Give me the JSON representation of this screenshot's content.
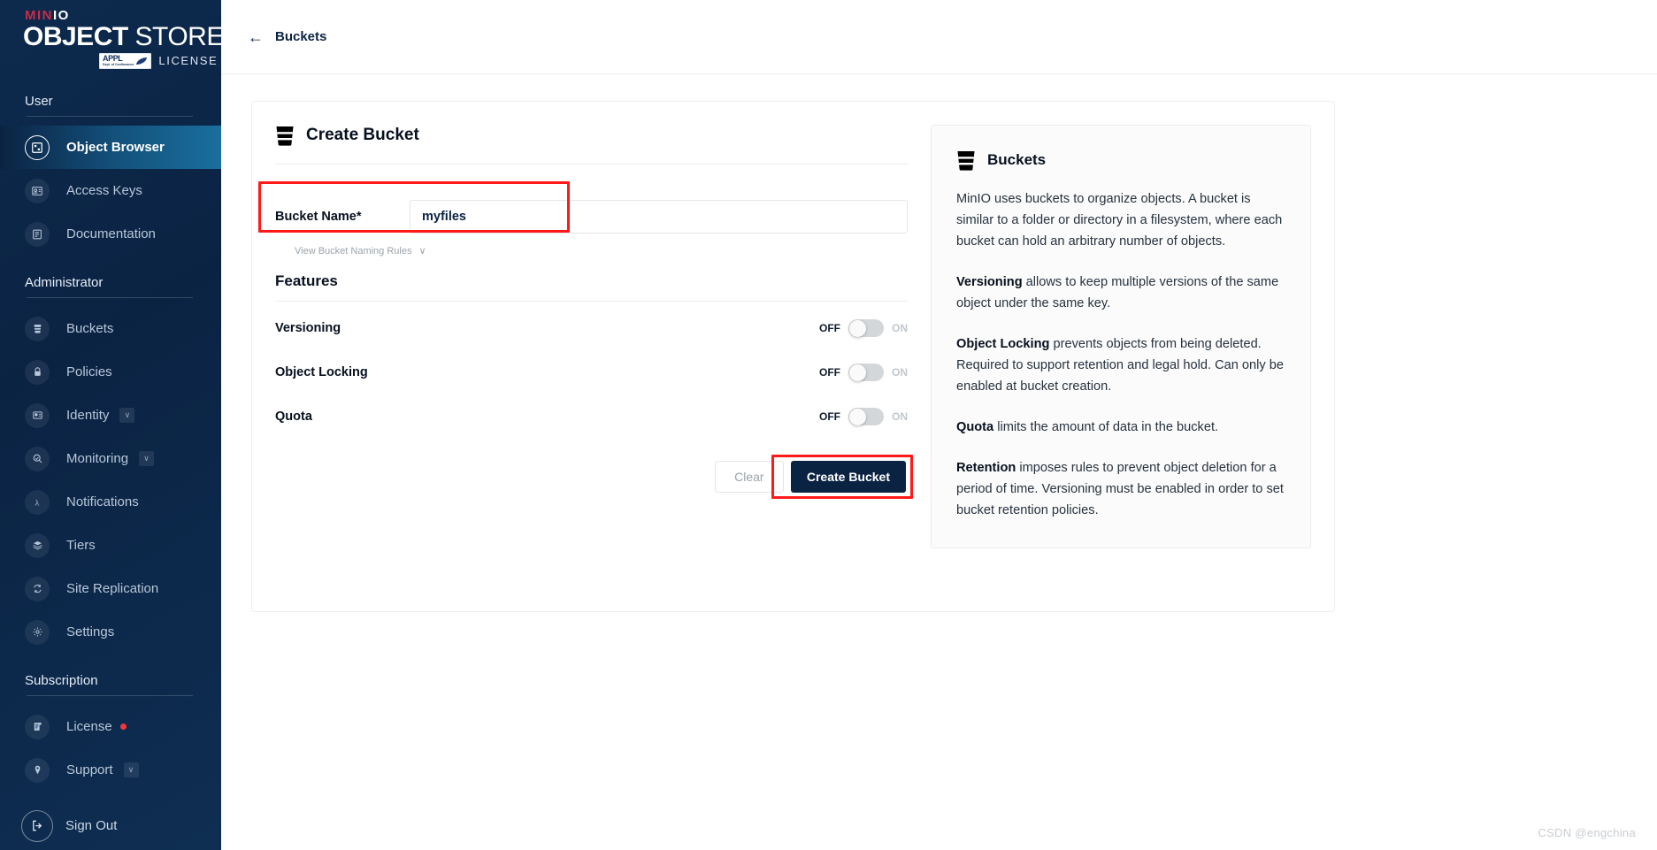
{
  "brand": {
    "minio": "MIN",
    "minio_io": "IO",
    "object": "OBJECT",
    "store": "STORE",
    "badge_main": "APPL",
    "badge_sub": "Dept. of Confirmance",
    "license": "LICENSE"
  },
  "sidebar": {
    "sections": [
      {
        "title": "User",
        "items": [
          {
            "label": "Object Browser",
            "icon": "object-browser-icon",
            "active": true
          },
          {
            "label": "Access Keys",
            "icon": "access-keys-icon",
            "active": false
          },
          {
            "label": "Documentation",
            "icon": "documentation-icon",
            "active": false
          }
        ]
      },
      {
        "title": "Administrator",
        "items": [
          {
            "label": "Buckets",
            "icon": "buckets-icon",
            "active": false
          },
          {
            "label": "Policies",
            "icon": "policies-icon",
            "active": false
          },
          {
            "label": "Identity",
            "icon": "identity-icon",
            "active": false,
            "chevron": "∨"
          },
          {
            "label": "Monitoring",
            "icon": "monitoring-icon",
            "active": false,
            "chevron": "∨"
          },
          {
            "label": "Notifications",
            "icon": "notifications-icon",
            "active": false
          },
          {
            "label": "Tiers",
            "icon": "tiers-icon",
            "active": false
          },
          {
            "label": "Site Replication",
            "icon": "site-replication-icon",
            "active": false
          },
          {
            "label": "Settings",
            "icon": "settings-icon",
            "active": false
          }
        ]
      },
      {
        "title": "Subscription",
        "items": [
          {
            "label": "License",
            "icon": "license-icon",
            "active": false,
            "dot": true
          },
          {
            "label": "Support",
            "icon": "support-icon",
            "active": false,
            "chevron": "∨"
          }
        ]
      }
    ],
    "sign_out": {
      "label": "Sign Out",
      "icon": "sign-out-icon"
    }
  },
  "topbar": {
    "back_icon": "←",
    "breadcrumb": "Buckets"
  },
  "create_bucket": {
    "title": "Create Bucket",
    "title_icon": "bucket-icon",
    "bucket_name_label": "Bucket Name*",
    "bucket_name_value": "myfiles",
    "bucket_name_placeholder": "",
    "naming_rules_label": "View Bucket Naming Rules",
    "naming_rules_chevron": "∨",
    "features_title": "Features",
    "features": [
      {
        "name": "Versioning",
        "off_label": "OFF",
        "on_label": "ON",
        "state": "OFF"
      },
      {
        "name": "Object Locking",
        "off_label": "OFF",
        "on_label": "ON",
        "state": "OFF"
      },
      {
        "name": "Quota",
        "off_label": "OFF",
        "on_label": "ON",
        "state": "OFF"
      }
    ],
    "clear_label": "Clear",
    "submit_label": "Create Bucket"
  },
  "info_panel": {
    "title": "Buckets",
    "title_icon": "bucket-icon",
    "paragraphs": [
      {
        "lead": "",
        "text": "MinIO uses buckets to organize objects. A bucket is similar to a folder or directory in a filesystem, where each bucket can hold an arbitrary number of objects."
      },
      {
        "lead": "Versioning",
        "text": " allows to keep multiple versions of the same object under the same key."
      },
      {
        "lead": "Object Locking",
        "text": " prevents objects from being deleted. Required to support retention and legal hold. Can only be enabled at bucket creation."
      },
      {
        "lead": "Quota",
        "text": " limits the amount of data in the bucket."
      },
      {
        "lead": "Retention",
        "text": " imposes rules to prevent object deletion for a period of time. Versioning must be enabled in order to set bucket retention policies."
      }
    ]
  },
  "watermark": "CSDN @engchina",
  "colors": {
    "sidebar_bg": "#0b2343",
    "accent_red": "#C72C48",
    "annotation_red": "#ff1a1a",
    "primary_button": "#0b2343",
    "active_nav_gradient_end": "#1a6f9e"
  }
}
